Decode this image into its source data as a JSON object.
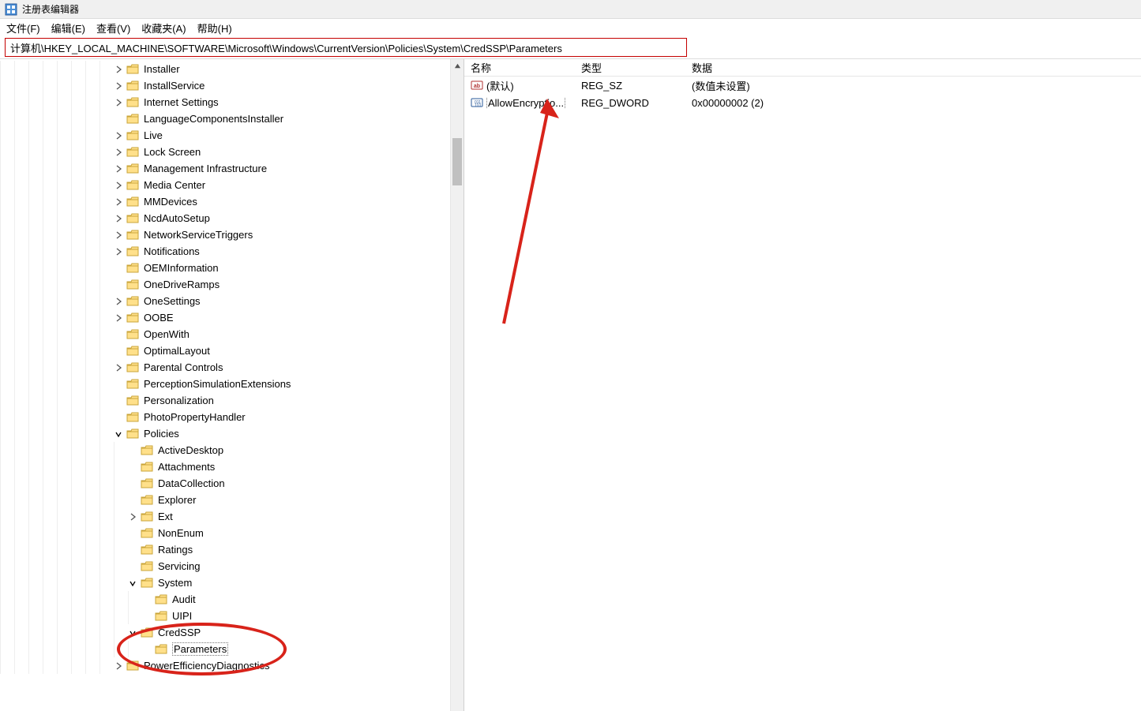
{
  "app": {
    "title": "注册表编辑器"
  },
  "menubar": {
    "file": "文件(F)",
    "edit": "编辑(E)",
    "view": "查看(V)",
    "favorites": "收藏夹(A)",
    "help": "帮助(H)"
  },
  "address": "计算机\\HKEY_LOCAL_MACHINE\\SOFTWARE\\Microsoft\\Windows\\CurrentVersion\\Policies\\System\\CredSSP\\Parameters",
  "tree": [
    {
      "indent": 8,
      "expander": "collapsed",
      "label": "Installer"
    },
    {
      "indent": 8,
      "expander": "collapsed",
      "label": "InstallService"
    },
    {
      "indent": 8,
      "expander": "collapsed",
      "label": "Internet Settings"
    },
    {
      "indent": 8,
      "expander": "none",
      "label": "LanguageComponentsInstaller"
    },
    {
      "indent": 8,
      "expander": "collapsed",
      "label": "Live"
    },
    {
      "indent": 8,
      "expander": "collapsed",
      "label": "Lock Screen"
    },
    {
      "indent": 8,
      "expander": "collapsed",
      "label": "Management Infrastructure"
    },
    {
      "indent": 8,
      "expander": "collapsed",
      "label": "Media Center"
    },
    {
      "indent": 8,
      "expander": "collapsed",
      "label": "MMDevices"
    },
    {
      "indent": 8,
      "expander": "collapsed",
      "label": "NcdAutoSetup"
    },
    {
      "indent": 8,
      "expander": "collapsed",
      "label": "NetworkServiceTriggers"
    },
    {
      "indent": 8,
      "expander": "collapsed",
      "label": "Notifications"
    },
    {
      "indent": 8,
      "expander": "none",
      "label": "OEMInformation"
    },
    {
      "indent": 8,
      "expander": "none",
      "label": "OneDriveRamps"
    },
    {
      "indent": 8,
      "expander": "collapsed",
      "label": "OneSettings"
    },
    {
      "indent": 8,
      "expander": "collapsed",
      "label": "OOBE"
    },
    {
      "indent": 8,
      "expander": "none",
      "label": "OpenWith"
    },
    {
      "indent": 8,
      "expander": "none",
      "label": "OptimalLayout"
    },
    {
      "indent": 8,
      "expander": "collapsed",
      "label": "Parental Controls"
    },
    {
      "indent": 8,
      "expander": "none",
      "label": "PerceptionSimulationExtensions"
    },
    {
      "indent": 8,
      "expander": "none",
      "label": "Personalization"
    },
    {
      "indent": 8,
      "expander": "none",
      "label": "PhotoPropertyHandler"
    },
    {
      "indent": 8,
      "expander": "expanded",
      "label": "Policies"
    },
    {
      "indent": 9,
      "expander": "none",
      "label": "ActiveDesktop"
    },
    {
      "indent": 9,
      "expander": "none",
      "label": "Attachments"
    },
    {
      "indent": 9,
      "expander": "none",
      "label": "DataCollection"
    },
    {
      "indent": 9,
      "expander": "none",
      "label": "Explorer"
    },
    {
      "indent": 9,
      "expander": "collapsed",
      "label": "Ext"
    },
    {
      "indent": 9,
      "expander": "none",
      "label": "NonEnum"
    },
    {
      "indent": 9,
      "expander": "none",
      "label": "Ratings"
    },
    {
      "indent": 9,
      "expander": "none",
      "label": "Servicing"
    },
    {
      "indent": 9,
      "expander": "expanded",
      "label": "System"
    },
    {
      "indent": 10,
      "expander": "none",
      "label": "Audit"
    },
    {
      "indent": 10,
      "expander": "none",
      "label": "UIPI"
    },
    {
      "indent": 9,
      "expander": "expanded",
      "label": "CredSSP"
    },
    {
      "indent": 10,
      "expander": "none",
      "label": "Parameters",
      "selected": true
    },
    {
      "indent": 8,
      "expander": "collapsed",
      "label": "PowerEfficiencyDiagnostics"
    }
  ],
  "list": {
    "headers": {
      "name": "名称",
      "type": "类型",
      "data": "数据"
    },
    "rows": [
      {
        "icon": "string",
        "name": "(默认)",
        "type": "REG_SZ",
        "data": "(数值未设置)",
        "selected": false
      },
      {
        "icon": "binary",
        "name": "AllowEncryptio...",
        "type": "REG_DWORD",
        "data": "0x00000002 (2)",
        "selected": true
      }
    ]
  }
}
